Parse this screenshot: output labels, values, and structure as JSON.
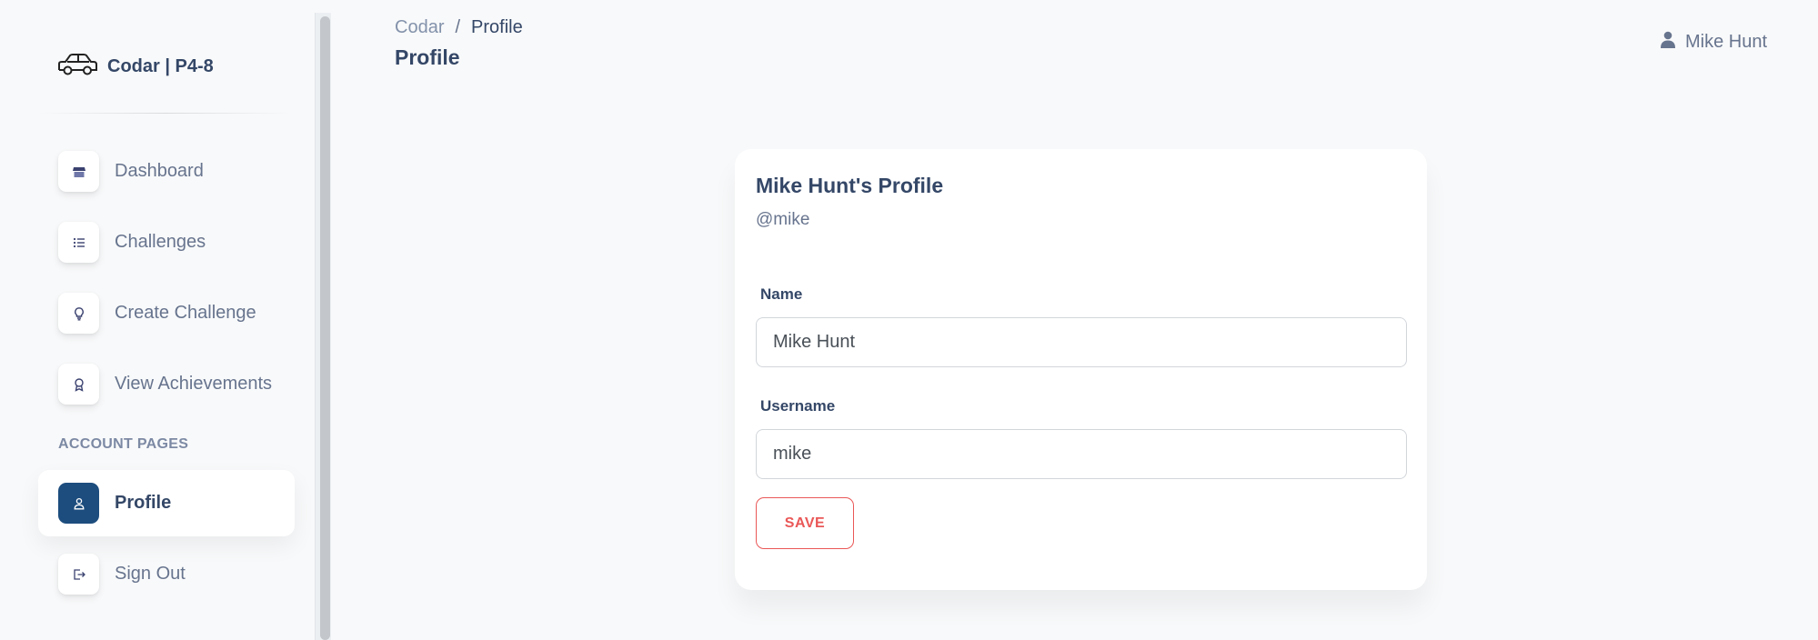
{
  "brand": {
    "title": "Codar | P4-8",
    "icon": "car-icon"
  },
  "sidebar": {
    "items": [
      {
        "label": "Dashboard",
        "icon": "shop-icon"
      },
      {
        "label": "Challenges",
        "icon": "list-icon"
      },
      {
        "label": "Create Challenge",
        "icon": "lightbulb-icon"
      },
      {
        "label": "View Achievements",
        "icon": "award-icon"
      }
    ],
    "section_heading": "ACCOUNT PAGES",
    "account_items": [
      {
        "label": "Profile",
        "icon": "user-icon",
        "active": true
      },
      {
        "label": "Sign Out",
        "icon": "sign-out-icon"
      }
    ]
  },
  "header": {
    "breadcrumb": {
      "root": "Codar",
      "separator": "/",
      "current": "Profile"
    },
    "title": "Profile",
    "user": {
      "name": "Mike Hunt",
      "icon": "user-icon"
    }
  },
  "profile_card": {
    "title": "Mike Hunt's Profile",
    "handle": "@mike",
    "name_label": "Name",
    "name_value": "Mike Hunt",
    "username_label": "Username",
    "username_value": "mike",
    "save_label": "SAVE"
  },
  "colors": {
    "accent": "#1d4d7e",
    "danger": "#ea5757",
    "text": "#344767",
    "muted": "#67748e",
    "background": "#f8f9fa"
  }
}
